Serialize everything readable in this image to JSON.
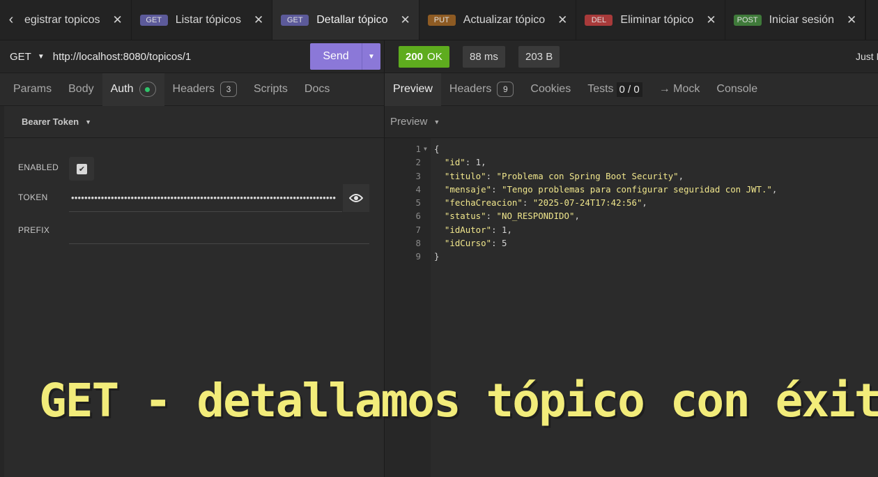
{
  "tabs": [
    {
      "method": "",
      "label": "egistrar topicos",
      "close": "✕",
      "active": false
    },
    {
      "method": "GET",
      "label": "Listar tópicos",
      "close": "✕",
      "active": false
    },
    {
      "method": "GET",
      "label": "Detallar tópico",
      "close": "✕",
      "active": true
    },
    {
      "method": "PUT",
      "label": "Actualizar tópico",
      "close": "✕",
      "active": false
    },
    {
      "method": "DEL",
      "label": "Eliminar tópico",
      "close": "✕",
      "active": false
    },
    {
      "method": "POST",
      "label": "Iniciar sesión",
      "close": "✕",
      "active": false
    }
  ],
  "request": {
    "method": "GET",
    "url": "http://localhost:8080/topicos/1",
    "send_label": "Send"
  },
  "response_status": {
    "code": "200",
    "text": "OK",
    "time": "88 ms",
    "size": "203 B",
    "timestamp": "Just N"
  },
  "request_tabs": {
    "params": "Params",
    "body": "Body",
    "auth": "Auth",
    "headers": "Headers",
    "headers_count": "3",
    "scripts": "Scripts",
    "docs": "Docs"
  },
  "auth": {
    "type": "Bearer Token",
    "enabled_label": "ENABLED",
    "enabled": true,
    "token_label": "TOKEN",
    "token_value": "••••••••••••••••••••••••••••••••••••••••••••••••••••••••••••••••••••••••••••••••",
    "prefix_label": "PREFIX",
    "prefix_value": ""
  },
  "response_tabs": {
    "preview": "Preview",
    "headers": "Headers",
    "headers_count": "9",
    "cookies": "Cookies",
    "tests": "Tests",
    "tests_score": "0 / 0",
    "mock": "→ Mock",
    "console": "Console"
  },
  "preview_mode": "Preview",
  "response_body": [
    {
      "n": "1",
      "tokens": [
        [
          "p",
          "{"
        ]
      ],
      "fold": true
    },
    {
      "n": "2",
      "tokens": [
        [
          "p",
          "  "
        ],
        [
          "k",
          "\"id\""
        ],
        [
          "p",
          ": 1,"
        ]
      ]
    },
    {
      "n": "3",
      "tokens": [
        [
          "p",
          "  "
        ],
        [
          "k",
          "\"titulo\""
        ],
        [
          "p",
          ": "
        ],
        [
          "s",
          "\"Problema con Spring Boot Security\""
        ],
        [
          "p",
          ","
        ]
      ]
    },
    {
      "n": "4",
      "tokens": [
        [
          "p",
          "  "
        ],
        [
          "k",
          "\"mensaje\""
        ],
        [
          "p",
          ": "
        ],
        [
          "s",
          "\"Tengo problemas para configurar seguridad con JWT.\""
        ],
        [
          "p",
          ","
        ]
      ]
    },
    {
      "n": "5",
      "tokens": [
        [
          "p",
          "  "
        ],
        [
          "k",
          "\"fechaCreacion\""
        ],
        [
          "p",
          ": "
        ],
        [
          "s",
          "\"2025-07-24T17:42:56\""
        ],
        [
          "p",
          ","
        ]
      ]
    },
    {
      "n": "6",
      "tokens": [
        [
          "p",
          "  "
        ],
        [
          "k",
          "\"status\""
        ],
        [
          "p",
          ": "
        ],
        [
          "s",
          "\"NO_RESPONDIDO\""
        ],
        [
          "p",
          ","
        ]
      ]
    },
    {
      "n": "7",
      "tokens": [
        [
          "p",
          "  "
        ],
        [
          "k",
          "\"idAutor\""
        ],
        [
          "p",
          ": 1,"
        ]
      ]
    },
    {
      "n": "8",
      "tokens": [
        [
          "p",
          "  "
        ],
        [
          "k",
          "\"idCurso\""
        ],
        [
          "p",
          ": 5"
        ]
      ]
    },
    {
      "n": "9",
      "tokens": [
        [
          "p",
          "}"
        ]
      ]
    }
  ],
  "caption": "GET - detallamos tópico con éxito",
  "colors": {
    "get": "#5c5a9a",
    "put": "#8e5b23",
    "del": "#a83a3a",
    "post": "#3f7a3a",
    "send": "#8b78d8",
    "ok": "#5eac1e",
    "auth_dot": "#2fc36a",
    "caption": "#f2ec7a"
  },
  "icons": {
    "scroll_left": "chevron-left-icon",
    "close": "close-icon",
    "caret": "caret-down-icon",
    "eye": "eye-icon",
    "check": "check-icon"
  }
}
